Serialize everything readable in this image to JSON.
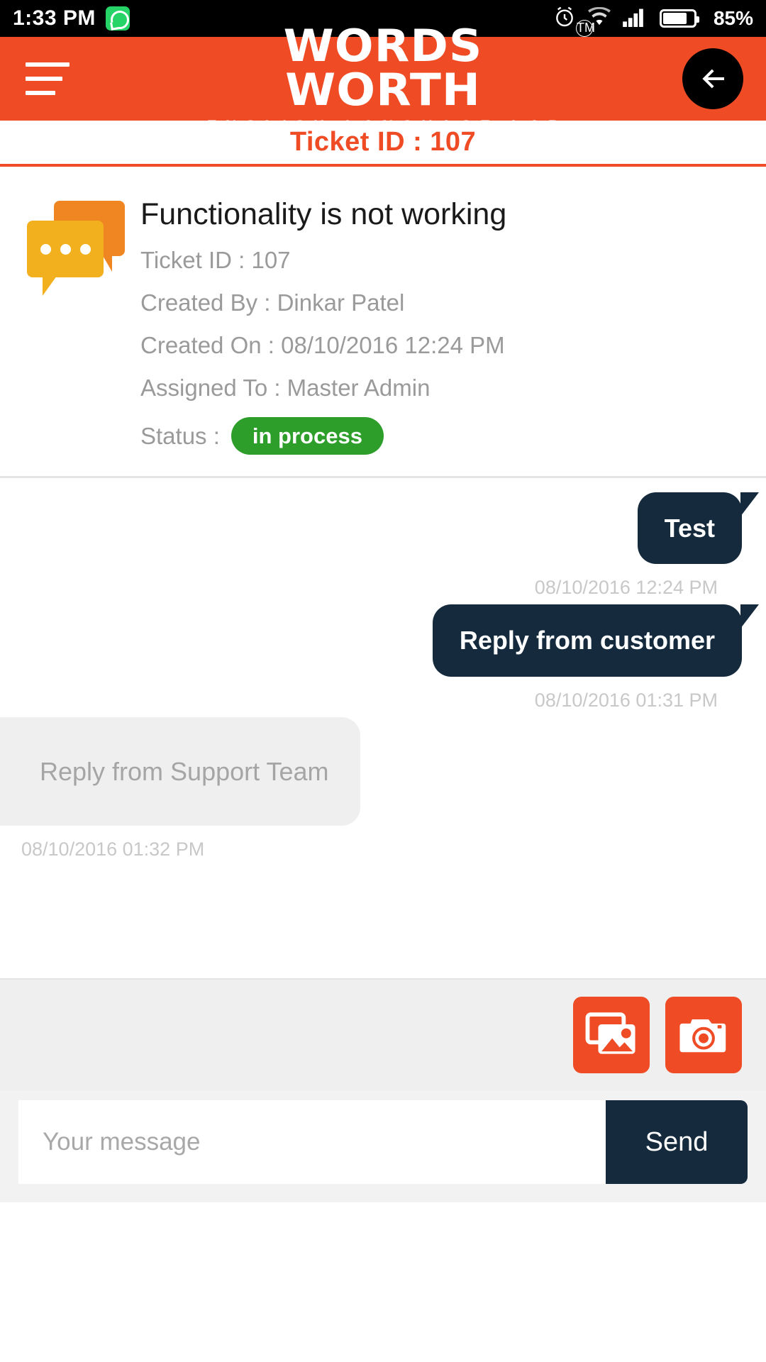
{
  "statusbar": {
    "time": "1:33 PM",
    "whatsapp_icon": "whatsapp-icon",
    "alarm_icon": "alarm-icon",
    "wifi_icon": "wifi-icon",
    "signal_icon": "signal-icon",
    "battery_icon": "battery-icon",
    "battery_percent": "85%"
  },
  "appbar": {
    "menu_icon": "hamburger-menu-icon",
    "brand_name": "WORDS WORTH",
    "brand_tm": "TM",
    "brand_subtitle": "ENGLISH LANGUAGE LAB",
    "back_icon": "back-arrow-icon",
    "background_color": "#ef4b25"
  },
  "ticket_header": {
    "label": "Ticket ID : 107",
    "color": "#ef4b25"
  },
  "ticket_detail": {
    "icon": "chat-bubbles-icon",
    "title": "Functionality is not working",
    "ticket_id": "Ticket ID : 107",
    "created_by": "Created By : Dinkar Patel",
    "created_on": "Created On : 08/10/2016 12:24 PM",
    "assigned_to": "Assigned To : Master Admin",
    "status_label": "Status :",
    "status_value": "in process",
    "status_color": "#2e9e2b"
  },
  "chat": {
    "messages": [
      {
        "text": "Test",
        "timestamp": "08/10/2016 12:24 PM",
        "side": "right"
      },
      {
        "text": "Reply from customer",
        "timestamp": "08/10/2016 01:31 PM",
        "side": "right"
      },
      {
        "text": "Reply from Support Team",
        "timestamp": "08/10/2016 01:32 PM",
        "side": "left"
      }
    ],
    "outgoing_bubble_color": "#152b3d",
    "incoming_bubble_color": "#efefef"
  },
  "attachments": {
    "gallery_icon": "gallery-image-icon",
    "camera_icon": "camera-icon",
    "button_color": "#ef4b25"
  },
  "composer": {
    "placeholder": "Your message",
    "value": "",
    "send_label": "Send",
    "send_color": "#152b3d"
  }
}
